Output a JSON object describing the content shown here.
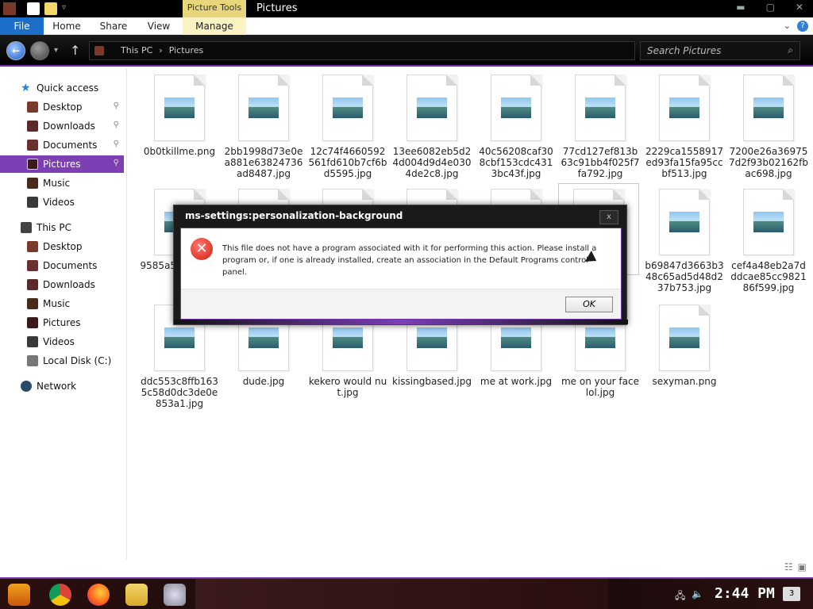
{
  "window": {
    "title": "Pictures",
    "picture_tools": "Picture Tools"
  },
  "ribbon": {
    "tabs": [
      "File",
      "Home",
      "Share",
      "View",
      "Manage"
    ]
  },
  "address": {
    "path": [
      "This PC",
      "Pictures"
    ],
    "search_placeholder": "Search Pictures"
  },
  "nav": {
    "quick_access": "Quick access",
    "quick_items": [
      "Desktop",
      "Downloads",
      "Documents",
      "Pictures",
      "Music",
      "Videos"
    ],
    "this_pc": "This PC",
    "pc_items": [
      "Desktop",
      "Documents",
      "Downloads",
      "Music",
      "Pictures",
      "Videos",
      "Local Disk (C:)"
    ],
    "network": "Network",
    "selected": "Pictures"
  },
  "files": [
    {
      "name": "0b0tkillme.png"
    },
    {
      "name": "2bb1998d73e0ea881e63824736ad8487.jpg"
    },
    {
      "name": "12c74f4660592561fd610b7cf6bd5595.jpg"
    },
    {
      "name": "13ee6082eb5d24d004d9d4e0304de2c8.jpg"
    },
    {
      "name": "40c56208caf308cbf153cdc4313bc43f.jpg"
    },
    {
      "name": "77cd127ef813b63c91bb4f025f7fa792.jpg"
    },
    {
      "name": "2229ca1558917ed93fa15fa95ccbf513.jpg"
    },
    {
      "name": "7200e26a369757d2f93b02162fbac698.jpg"
    },
    {
      "name": "9585a5520bdd8"
    },
    {
      "name": "b69847d3663b348c65ad5d48d237b753.jpg"
    },
    {
      "name": "cef4a48eb2a7dddcae85cc982186f599.jpg"
    },
    {
      "name": "ddc553c8ffb1635c58d0dc3de0e853a1.jpg"
    },
    {
      "name": "dude.jpg"
    },
    {
      "name": "kekero would nut.jpg"
    },
    {
      "name": "kissingbased.jpg"
    },
    {
      "name": "me at work.jpg"
    },
    {
      "name": "me on your face lol.jpg"
    },
    {
      "name": "sexyman.png"
    }
  ],
  "dialog": {
    "title": "ms-settings:personalization-background",
    "message": "This file does not have a program associated with it for performing this action. Please install a program or, if one is already installed, create an association in the Default Programs control panel.",
    "ok": "OK",
    "close": "x"
  },
  "taskbar": {
    "clock": "2:44 PM",
    "notifications": "3"
  },
  "colors": {
    "accent": "#7d3fb4",
    "file_tab": "#1c6fc9",
    "error": "#d21a12"
  }
}
